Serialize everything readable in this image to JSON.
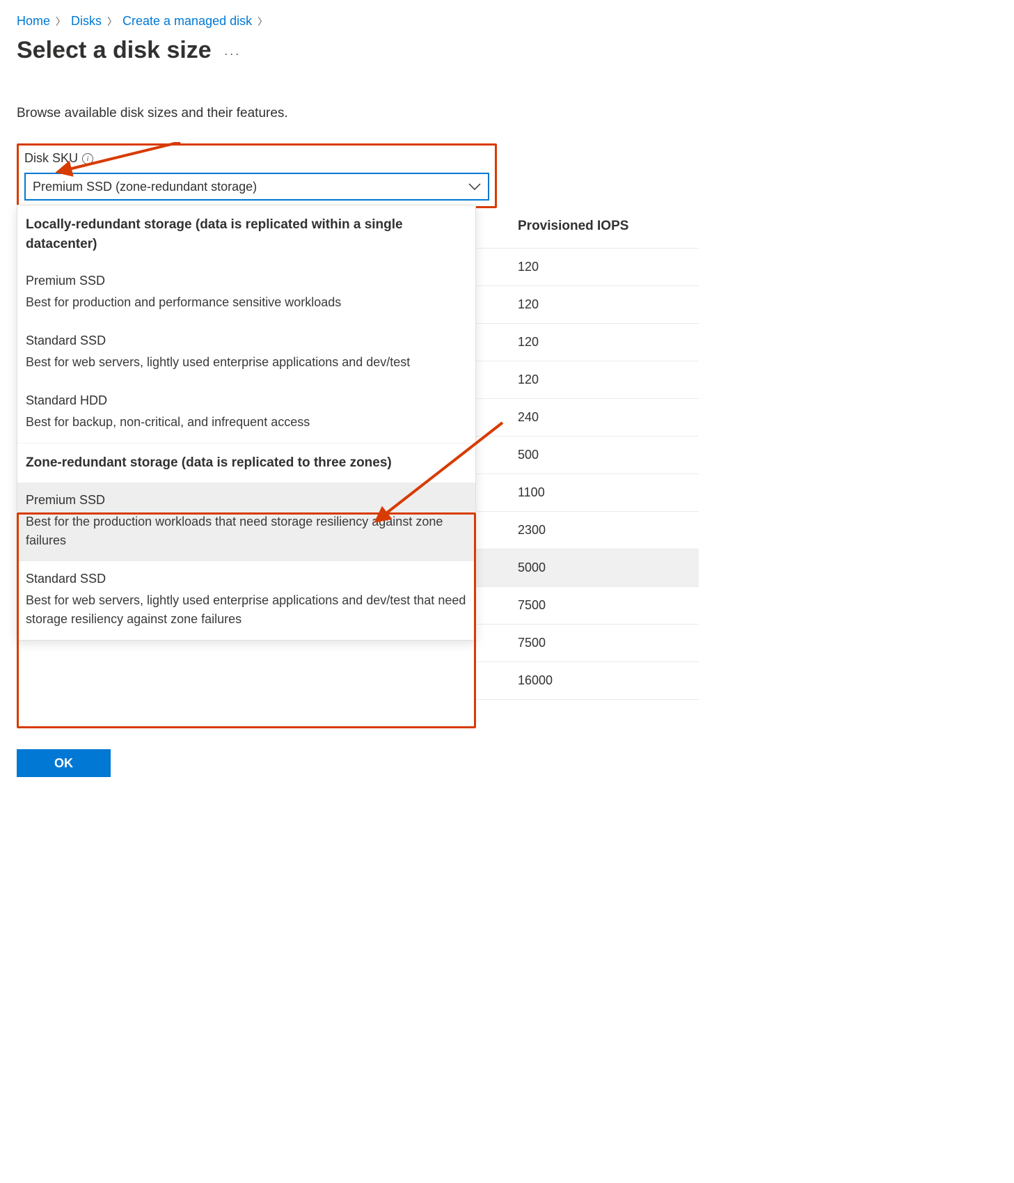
{
  "breadcrumb": {
    "home": "Home",
    "disks": "Disks",
    "create": "Create a managed disk"
  },
  "title": "Select a disk size",
  "description": "Browse available disk sizes and their features.",
  "sku": {
    "label": "Disk SKU",
    "selected": "Premium SSD (zone-redundant storage)"
  },
  "dropdown": {
    "group1_label": "Locally-redundant storage (data is replicated within a single datacenter)",
    "lrs_premium_title": "Premium SSD",
    "lrs_premium_sub": "Best for production and performance sensitive workloads",
    "lrs_stdssd_title": "Standard SSD",
    "lrs_stdssd_sub": "Best for web servers, lightly used enterprise applications and dev/test",
    "lrs_stdhdd_title": "Standard HDD",
    "lrs_stdhdd_sub": "Best for backup, non-critical, and infrequent access",
    "group2_label": "Zone-redundant storage (data is replicated to three zones)",
    "zrs_premium_title": "Premium SSD",
    "zrs_premium_sub": "Best for the production workloads that need storage resiliency against zone failures",
    "zrs_stdssd_title": "Standard SSD",
    "zrs_stdssd_sub": "Best for web servers, lightly used enterprise applications and dev/test that need storage resiliency against zone failures"
  },
  "table": {
    "header_iops": "Provisioned IOPS",
    "rows": [
      "120",
      "120",
      "120",
      "120",
      "240",
      "500",
      "1100",
      "2300",
      "5000",
      "7500",
      "7500",
      "16000"
    ]
  },
  "ok_label": "OK"
}
